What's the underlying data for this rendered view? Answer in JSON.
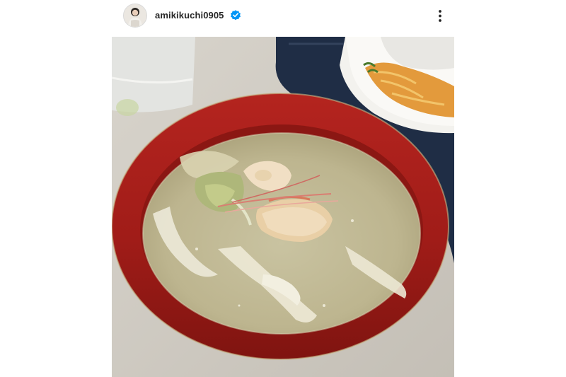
{
  "post": {
    "username": "amikikuchi0905",
    "verified": true,
    "icons": {
      "avatar": "profile-avatar",
      "verified": "verified-badge-icon",
      "more": "more-options-icon",
      "photo": "soup-bowl-photo"
    },
    "colors": {
      "verified_badge": "#0095f6",
      "username": "#262626"
    }
  }
}
